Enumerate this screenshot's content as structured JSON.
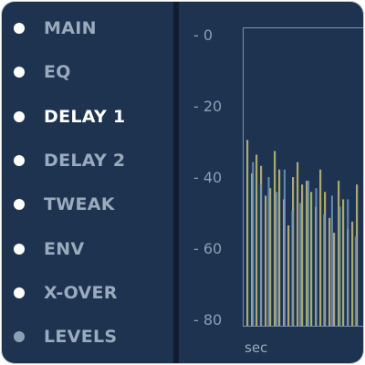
{
  "nav": {
    "items": [
      {
        "label": "MAIN",
        "active": false
      },
      {
        "label": "EQ",
        "active": false
      },
      {
        "label": "DELAY 1",
        "active": true
      },
      {
        "label": "DELAY 2",
        "active": false
      },
      {
        "label": "TWEAK",
        "active": false
      },
      {
        "label": "ENV",
        "active": false
      },
      {
        "label": "X-OVER",
        "active": false
      },
      {
        "label": "LEVELS",
        "active": false,
        "dimmed": true
      }
    ]
  },
  "meter": {
    "scale_labels": [
      "- 0",
      "- 20",
      "- 40",
      "- 60",
      "- 80"
    ],
    "unit_label": "sec",
    "colors": {
      "background": "#1d3350",
      "bar_yellow": "#c9bd73",
      "bar_blue": "#6f93b8"
    }
  },
  "chart_data": {
    "type": "bar",
    "ylim": [
      -80,
      0
    ],
    "tick_labels": [
      "- 0",
      "- 20",
      "- 40",
      "- 60",
      "- 80"
    ],
    "xlabel": "sec",
    "series": [
      {
        "color": "yellow",
        "values": [
          -30,
          -39,
          -34,
          -37,
          -45,
          -43,
          -33,
          -38,
          -46,
          -53,
          -40,
          -36,
          -42,
          -41,
          -44,
          -48,
          -38,
          -44,
          -51,
          -55,
          -41,
          -46,
          -54,
          -52,
          -42
        ]
      },
      {
        "color": "blue",
        "values": [
          -36,
          -42,
          -40,
          -44,
          -38,
          -49,
          -47,
          -41,
          -43,
          -50,
          -45,
          -48,
          -46,
          -56
        ]
      }
    ]
  }
}
